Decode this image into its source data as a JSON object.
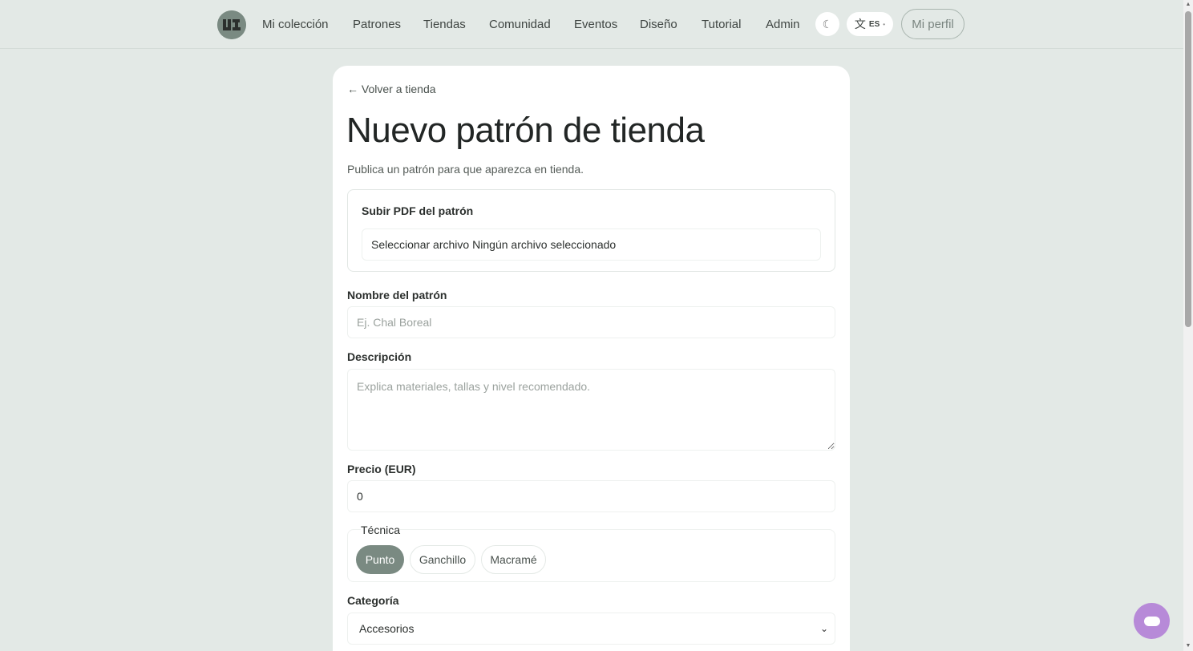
{
  "nav": {
    "items": [
      {
        "label": "Mi colección",
        "name": "nav-mi-coleccion"
      },
      {
        "label": "Patrones",
        "name": "nav-patrones"
      },
      {
        "label": "Tiendas",
        "name": "nav-tiendas"
      },
      {
        "label": "Comunidad",
        "name": "nav-comunidad"
      },
      {
        "label": "Eventos",
        "name": "nav-eventos"
      },
      {
        "label": "Diseño",
        "name": "nav-diseno"
      },
      {
        "label": "Tutorial",
        "name": "nav-tutorial"
      },
      {
        "label": "Admin",
        "name": "nav-admin"
      }
    ],
    "theme_icon": "☾",
    "lang_glyph": "文",
    "lang_code": "ES",
    "lang_dot": "•",
    "profile_label": "Mi perfil"
  },
  "form": {
    "back_label": "← Volver a tienda",
    "title": "Nuevo patrón de tienda",
    "subtitle": "Publica un patrón para que aparezca en tienda.",
    "upload": {
      "label": "Subir PDF del patrón",
      "button_text": "Seleccionar archivo",
      "status_text": "Ningún archivo seleccionado"
    },
    "name": {
      "label": "Nombre del patrón",
      "placeholder": "Ej. Chal Boreal",
      "value": ""
    },
    "description": {
      "label": "Descripción",
      "placeholder": "Explica materiales, tallas y nivel recomendado."
    },
    "price": {
      "label": "Precio (EUR)",
      "value": "0"
    },
    "technique": {
      "label": "Técnica",
      "options": [
        "Punto",
        "Ganchillo",
        "Macramé"
      ],
      "selected": "Punto"
    },
    "category": {
      "label": "Categoría",
      "selected": "Accesorios",
      "chevron": "⌄"
    }
  },
  "colors": {
    "background": "#e3e9e6",
    "accent": "#7a8a82",
    "chat_fab": "#b78ad8"
  }
}
